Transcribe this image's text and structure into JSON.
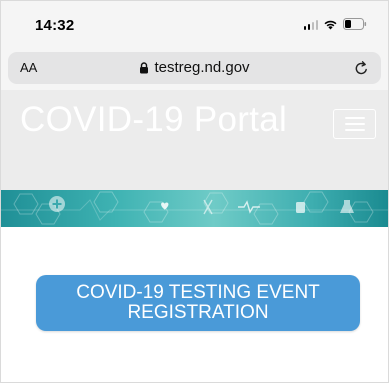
{
  "status_bar": {
    "time": "14:32",
    "icons": [
      "cellular-signal-icon",
      "wifi-icon",
      "battery-icon"
    ]
  },
  "browser": {
    "text_size_label": "AA",
    "url": "testreg.nd.gov",
    "lock_icon": "lock-icon",
    "reload_icon": "reload-icon"
  },
  "site": {
    "title": "COVID-19 Portal",
    "menu_icon": "hamburger-menu-icon",
    "header_color": "#ececec",
    "banner_colors": [
      "#1f8f96",
      "#6fcbc7"
    ]
  },
  "main": {
    "cta_line1": "COVID-19 TESTING EVENT",
    "cta_line2": "REGISTRATION",
    "cta_color": "#4a9ad8"
  }
}
